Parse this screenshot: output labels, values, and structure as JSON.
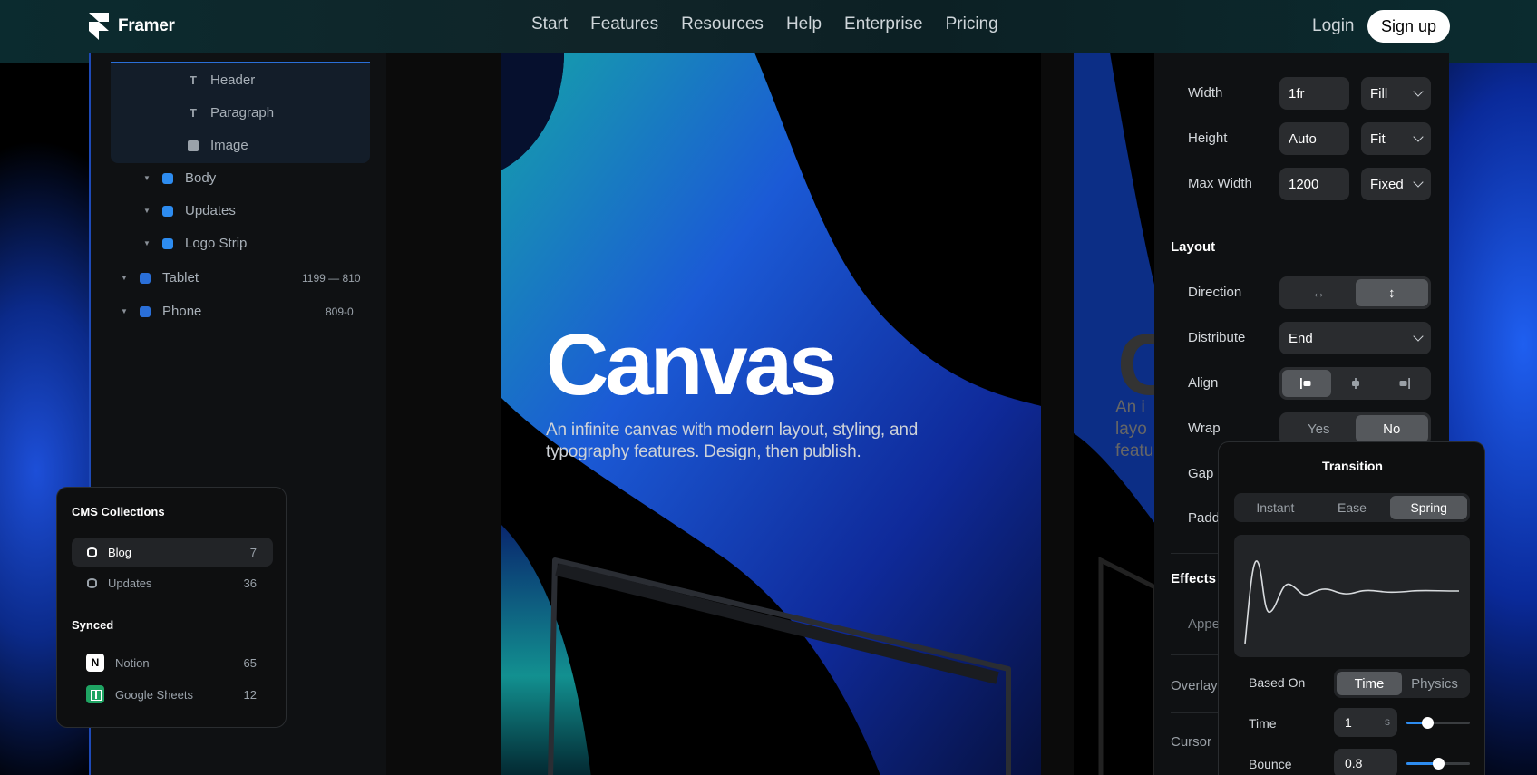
{
  "nav": {
    "brand": "Framer",
    "links": [
      "Start",
      "Features",
      "Resources",
      "Help",
      "Enterprise",
      "Pricing"
    ],
    "login": "Login",
    "signup": "Sign up"
  },
  "layers": {
    "items": [
      {
        "label": "Header",
        "type": "text"
      },
      {
        "label": "Paragraph",
        "type": "text"
      },
      {
        "label": "Image",
        "type": "image"
      },
      {
        "label": "Body",
        "type": "stack"
      },
      {
        "label": "Updates",
        "type": "stack"
      },
      {
        "label": "Logo Strip",
        "type": "stack"
      },
      {
        "label": "Tablet",
        "type": "frame",
        "range": "1199 — 810"
      },
      {
        "label": "Phone",
        "type": "frame",
        "range": "809-0"
      }
    ]
  },
  "canvas": {
    "title": "Canvas",
    "subtitle": "An infinite canvas with modern layout, styling, and typography features. Design, then publish.",
    "ghost_title": "C",
    "ghost_sub": "An i layo featu"
  },
  "properties": {
    "width": {
      "label": "Width",
      "value": "1fr",
      "mode": "Fill"
    },
    "height": {
      "label": "Height",
      "value": "Auto",
      "mode": "Fit"
    },
    "max_width": {
      "label": "Max Width",
      "value": "1200",
      "mode": "Fixed"
    },
    "layout_heading": "Layout",
    "direction": {
      "label": "Direction",
      "options": [
        "↔",
        "↕"
      ],
      "active": 1
    },
    "distribute": {
      "label": "Distribute",
      "value": "End"
    },
    "align": {
      "label": "Align",
      "active": 0
    },
    "wrap": {
      "label": "Wrap",
      "options": [
        "Yes",
        "No"
      ],
      "active": 1
    },
    "gap_label": "Gap",
    "padding_label": "Padd",
    "effects_heading": "Effects",
    "appear_label": "Appe",
    "overlay_label": "Overlay",
    "cursor_label": "Cursor"
  },
  "transition": {
    "title": "Transition",
    "types": [
      "Instant",
      "Ease",
      "Spring"
    ],
    "active_type": 2,
    "based_on_label": "Based On",
    "based_on_options": [
      "Time",
      "Physics"
    ],
    "based_on_active": 0,
    "time_label": "Time",
    "time_value": "1",
    "time_unit": "s",
    "time_slider": 0.33,
    "bounce_label": "Bounce",
    "bounce_value": "0.8",
    "bounce_slider": 0.5
  },
  "cms": {
    "collections_heading": "CMS Collections",
    "collections": [
      {
        "label": "Blog",
        "count": "7",
        "active": true
      },
      {
        "label": "Updates",
        "count": "36",
        "active": false
      }
    ],
    "synced_heading": "Synced",
    "synced": [
      {
        "label": "Notion",
        "count": "65",
        "icon": "notion-icon"
      },
      {
        "label": "Google Sheets",
        "count": "12",
        "icon": "google-sheets-icon"
      }
    ]
  },
  "colors": {
    "accent": "#2d8cf0",
    "panel": "#0f1113",
    "input": "#2a2c2f"
  }
}
